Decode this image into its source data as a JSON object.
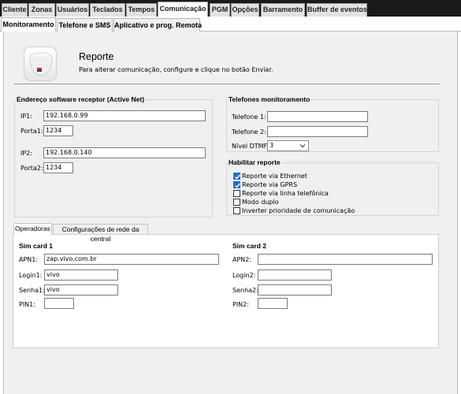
{
  "main_tabs": [
    "Cliente",
    "Zonas",
    "Usuários",
    "Teclados",
    "Tempos",
    "Comunicação",
    "PGM",
    "Opções",
    "Barramento",
    "Buffer de eventos"
  ],
  "sub_tabs": [
    "Monitoramento",
    "Telefone e SMS",
    "Aplicativo e prog. Remota"
  ],
  "header": {
    "icon": "alarm-panel-icon",
    "title": "Reporte",
    "subtitle": "Para alterar comunicação, configure e clique no botão Enviar."
  },
  "receiver": {
    "title": "Endereço software receptor (Active Net)",
    "ip1_label": "IP1:",
    "ip1_value": "192.168.0.99",
    "porta1_label": "Porta1:",
    "porta1_value": "1234",
    "ip2_label": "IP2:",
    "ip2_value": "192.168.0.140",
    "porta2_label": "Porta2:",
    "porta2_value": "1234"
  },
  "phones": {
    "title": "Telefones monitoramento",
    "tel1_label": "Telefone 1:",
    "tel1_value": "",
    "tel2_label": "Telefone 2:",
    "tel2_value": "",
    "dtmf_label": "Nível DTMF:",
    "dtmf_value": "3"
  },
  "report": {
    "title": "Habilitar reporte",
    "options": [
      {
        "label": "Reporte via Ethernet",
        "checked": true
      },
      {
        "label": "Reporte via GPRS",
        "checked": true
      },
      {
        "label": "Reporte via linha telefônica",
        "checked": false
      },
      {
        "label": "Modo duplo",
        "checked": false
      },
      {
        "label": "Inverter prioridade de comunicação",
        "checked": false
      }
    ]
  },
  "inner_tabs": [
    "Operadoras",
    "Configurações de rede da central"
  ],
  "sim1": {
    "title": "Sim card 1",
    "apn_label": "APN1:",
    "apn_value": "zap.vivo.com.br",
    "login_label": "Login1:",
    "login_value": "vivo",
    "senha_label": "Senha1:",
    "senha_value": "vivo",
    "pin_label": "PIN1:",
    "pin_value": ""
  },
  "sim2": {
    "title": "Sim card 2",
    "apn_label": "APN2:",
    "apn_value": "",
    "login_label": "Login2:",
    "login_value": "",
    "senha_label": "Senha2:",
    "senha_value": "",
    "pin_label": "PIN2:",
    "pin_value": ""
  },
  "colors": {
    "checkbox_checked": "#1f6fcf",
    "tab_bar": "#1a1a1a",
    "panel": "#f0f0f0"
  }
}
